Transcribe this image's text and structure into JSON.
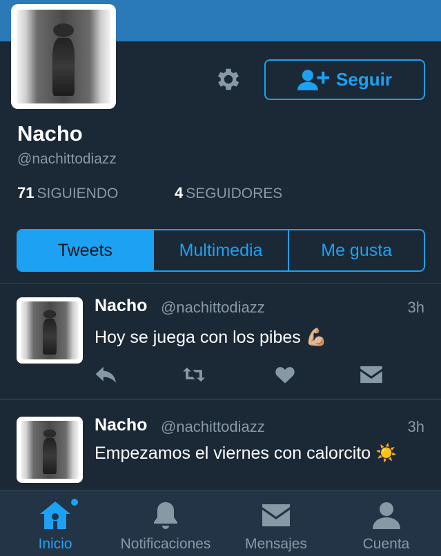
{
  "profile": {
    "name": "Nacho",
    "handle": "@nachittodiazz",
    "following_count": "71",
    "following_label": "SIGUIENDO",
    "followers_count": "4",
    "followers_label": "SEGUIDORES",
    "follow_button": "Seguir"
  },
  "tabs": [
    {
      "label": "Tweets",
      "active": true
    },
    {
      "label": "Multimedia",
      "active": false
    },
    {
      "label": "Me gusta",
      "active": false
    }
  ],
  "tweets": [
    {
      "name": "Nacho",
      "handle": "@nachittodiazz",
      "time": "3h",
      "text": "Hoy se juega con los pibes 💪🏼"
    },
    {
      "name": "Nacho",
      "handle": "@nachittodiazz",
      "time": "3h",
      "text": "Empezamos el viernes con calorcito ☀️"
    }
  ],
  "nav": [
    {
      "label": "Inicio",
      "icon": "home-icon",
      "active": true
    },
    {
      "label": "Notificaciones",
      "icon": "bell-icon",
      "active": false
    },
    {
      "label": "Mensajes",
      "icon": "envelope-icon",
      "active": false
    },
    {
      "label": "Cuenta",
      "icon": "person-icon",
      "active": false
    }
  ],
  "colors": {
    "background": "#1b2836",
    "accent": "#1da1f2",
    "banner": "#2a7ab9",
    "muted": "#8899a6"
  }
}
